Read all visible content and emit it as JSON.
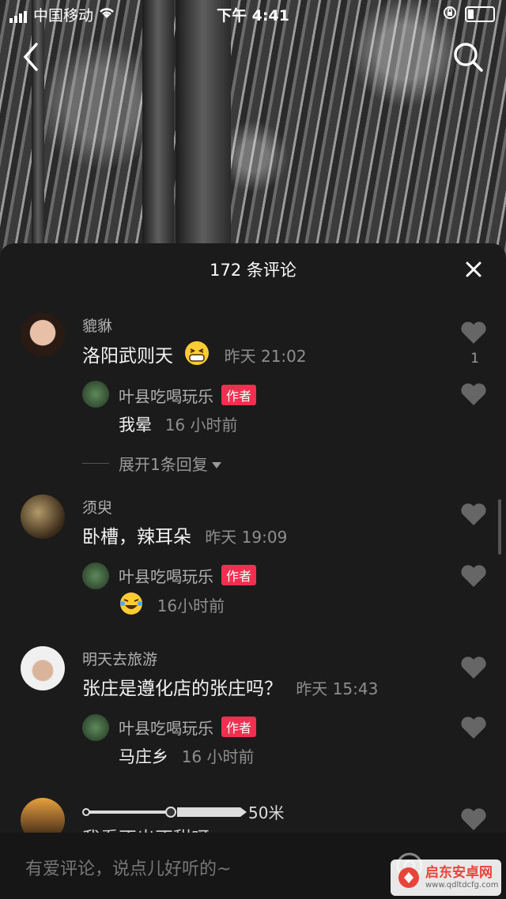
{
  "status_bar": {
    "carrier": "中国移动",
    "time": "下午 4:41"
  },
  "header": {
    "comment_count_title": "172 条评论"
  },
  "comments": [
    {
      "user": "貔貅",
      "text": "洛阳武则天",
      "time": "昨天 21:02",
      "likes": "1",
      "reply": {
        "user": "叶县吃喝玩乐",
        "badge": "作者",
        "text": "我晕",
        "time": "16 小时前"
      },
      "expand": "展开1条回复"
    },
    {
      "user": "须臾",
      "text": "卧槽，辣耳朵",
      "time": "昨天 19:09",
      "reply": {
        "user": "叶县吃喝玩乐",
        "badge": "作者",
        "text": "",
        "time": "16小时前"
      }
    },
    {
      "user": "明天去旅游",
      "text": "张庄是遵化店的张庄吗？",
      "time": "昨天 15:43",
      "reply": {
        "user": "叶县吃喝玩乐",
        "badge": "作者",
        "text": "马庄乡",
        "time": "16 小时前"
      }
    }
  ],
  "map_scale": "50米",
  "partial_comment": "我看不出不甜呀",
  "input": {
    "placeholder": "有爱评论，说点儿好听的~"
  },
  "watermark": {
    "text": "启东安卓网",
    "url": "www.qdltdcfg.com"
  },
  "colors": {
    "badge": "#f0304e",
    "sheet_bg": "#1b1b1b"
  }
}
